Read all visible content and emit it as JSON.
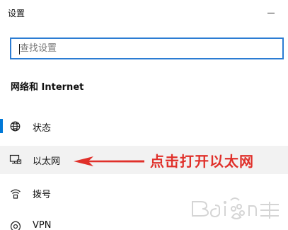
{
  "window": {
    "title": "设置"
  },
  "search": {
    "placeholder": "查找设置",
    "value": ""
  },
  "section": {
    "title": "网络和 Internet"
  },
  "nav": {
    "items": [
      {
        "label": "状态",
        "icon": "globe-status-icon",
        "selected": false
      },
      {
        "label": "以太网",
        "icon": "ethernet-monitor-icon",
        "selected": true
      },
      {
        "label": "拨号",
        "icon": "dialup-icon",
        "selected": false
      },
      {
        "label": "VPN",
        "icon": "vpn-icon",
        "selected": false
      }
    ]
  },
  "annotation": {
    "text": "点击打开以太网",
    "color": "#e0302a"
  },
  "colors": {
    "accent": "#0078d7",
    "search_border": "#2b7cd3",
    "selected_bg": "#f2f2f2"
  }
}
